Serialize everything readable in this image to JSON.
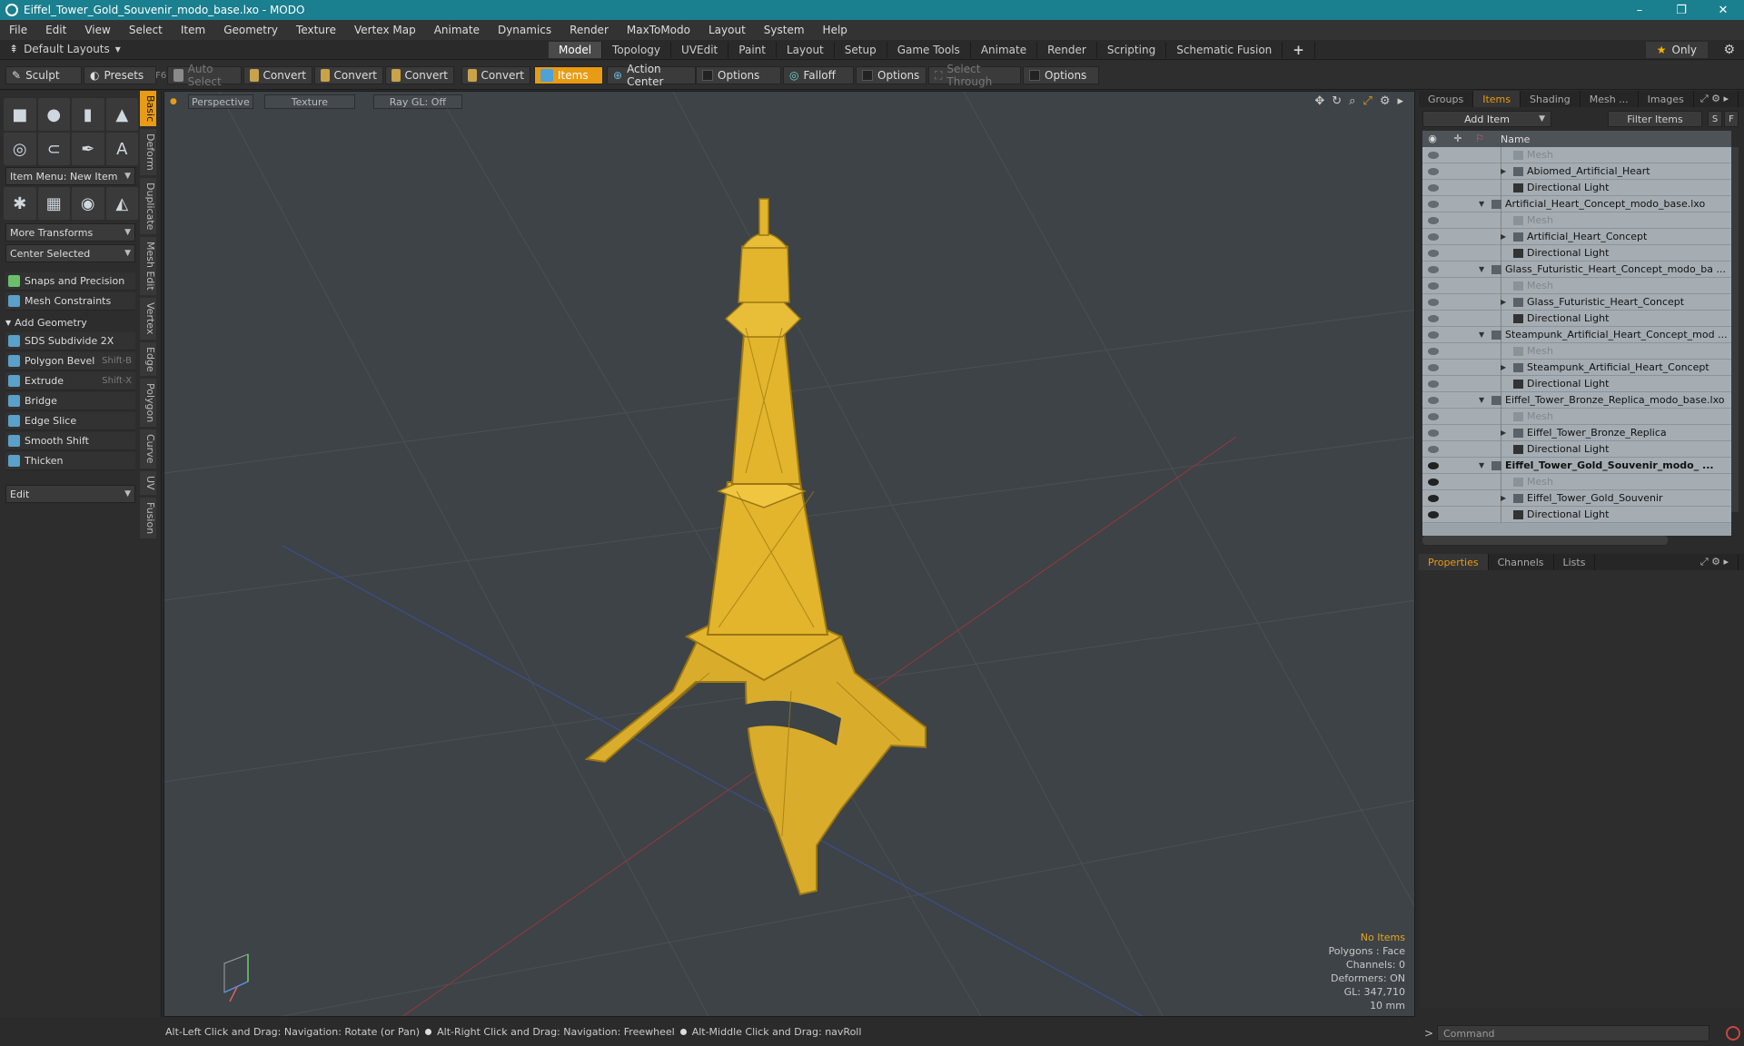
{
  "window": {
    "title": "Eiffel_Tower_Gold_Souvenir_modo_base.lxo - MODO",
    "controls": [
      "–",
      "❐",
      "✕"
    ]
  },
  "menu": [
    "File",
    "Edit",
    "View",
    "Select",
    "Item",
    "Geometry",
    "Texture",
    "Vertex Map",
    "Animate",
    "Dynamics",
    "Render",
    "MaxToModo",
    "Layout",
    "System",
    "Help"
  ],
  "layoutbar": {
    "layouts_label": "Default Layouts",
    "tabs": [
      "Model",
      "Topology",
      "UVEdit",
      "Paint",
      "Layout",
      "Setup",
      "Game Tools",
      "Animate",
      "Render",
      "Scripting",
      "Schematic Fusion"
    ],
    "active_tab": "Model",
    "plus": "+",
    "only_label": "Only"
  },
  "toolbar": {
    "sculpt": "Sculpt",
    "presets": "Presets",
    "presets_key": "F6",
    "auto_select": "Auto Select",
    "convert1": "Convert",
    "convert2": "Convert",
    "convert3": "Convert",
    "convert4": "Convert",
    "items": "Items",
    "action_center": "Action Center",
    "options1": "Options",
    "falloff": "Falloff",
    "options2": "Options",
    "select_through": "Select Through",
    "options3": "Options"
  },
  "leftpanel": {
    "item_menu": "Item Menu: New Item",
    "more_transforms": "More Transforms",
    "center_selected": "Center Selected",
    "snaps": "Snaps and Precision",
    "mesh_constraints": "Mesh Constraints",
    "add_geometry": "Add Geometry",
    "tools": [
      {
        "label": "SDS Subdivide 2X",
        "shortcut": ""
      },
      {
        "label": "Polygon Bevel",
        "shortcut": "Shift-B"
      },
      {
        "label": "Extrude",
        "shortcut": "Shift-X"
      },
      {
        "label": "Bridge",
        "shortcut": ""
      },
      {
        "label": "Edge Slice",
        "shortcut": ""
      },
      {
        "label": "Smooth Shift",
        "shortcut": ""
      },
      {
        "label": "Thicken",
        "shortcut": ""
      }
    ],
    "edit": "Edit",
    "side_tabs": [
      "Basic",
      "Deform",
      "Duplicate",
      "Mesh Edit",
      "Vertex",
      "Edge",
      "Polygon",
      "Curve",
      "UV",
      "Fusion"
    ]
  },
  "viewport": {
    "view": "Perspective",
    "shading": "Texture",
    "raygl": "Ray GL: Off",
    "info": {
      "no_items": "No Items",
      "polygons": "Polygons : Face",
      "channels": "Channels: 0",
      "deformers": "Deformers: ON",
      "gl": "GL: 347,710",
      "scale": "10 mm"
    },
    "colors": {
      "background": "#3d4347",
      "tower": "#e2b52d",
      "tower_dark": "#9c7712"
    }
  },
  "statusbar": {
    "hint1": "Alt-Left Click and Drag: Navigation: Rotate (or Pan)",
    "hint2": "Alt-Right Click and Drag: Navigation: Freewheel",
    "hint3": "Alt-Middle Click and Drag: navRoll"
  },
  "rightpanel": {
    "tabs": [
      "Groups",
      "Items",
      "Shading",
      "Mesh ...",
      "Images"
    ],
    "active_tab": "Items",
    "add_item": "Add Item",
    "filter_items": "Filter Items",
    "btn_s": "S",
    "btn_f": "F",
    "column_name": "Name",
    "tree": [
      {
        "label": "Mesh",
        "type": "mesh",
        "indent": 2,
        "tri": ""
      },
      {
        "label": "Abiomed_Artificial_Heart",
        "type": "item",
        "indent": 2,
        "tri": "▶"
      },
      {
        "label": "Directional Light",
        "type": "light",
        "indent": 2,
        "tri": ""
      },
      {
        "label": "Artificial_Heart_Concept_modo_base.lxo",
        "type": "scene",
        "indent": 1,
        "tri": "▼"
      },
      {
        "label": "Mesh",
        "type": "mesh",
        "indent": 2,
        "tri": ""
      },
      {
        "label": "Artificial_Heart_Concept",
        "type": "item",
        "indent": 2,
        "tri": "▶"
      },
      {
        "label": "Directional Light",
        "type": "light",
        "indent": 2,
        "tri": ""
      },
      {
        "label": "Glass_Futuristic_Heart_Concept_modo_ba ...",
        "type": "scene",
        "indent": 1,
        "tri": "▼"
      },
      {
        "label": "Mesh",
        "type": "mesh",
        "indent": 2,
        "tri": ""
      },
      {
        "label": "Glass_Futuristic_Heart_Concept",
        "type": "item",
        "indent": 2,
        "tri": "▶"
      },
      {
        "label": "Directional Light",
        "type": "light",
        "indent": 2,
        "tri": ""
      },
      {
        "label": "Steampunk_Artificial_Heart_Concept_mod ...",
        "type": "scene",
        "indent": 1,
        "tri": "▼"
      },
      {
        "label": "Mesh",
        "type": "mesh",
        "indent": 2,
        "tri": ""
      },
      {
        "label": "Steampunk_Artificial_Heart_Concept",
        "type": "item",
        "indent": 2,
        "tri": "▶"
      },
      {
        "label": "Directional Light",
        "type": "light",
        "indent": 2,
        "tri": ""
      },
      {
        "label": "Eiffel_Tower_Bronze_Replica_modo_base.lxo",
        "type": "scene",
        "indent": 1,
        "tri": "▼"
      },
      {
        "label": "Mesh",
        "type": "mesh",
        "indent": 2,
        "tri": ""
      },
      {
        "label": "Eiffel_Tower_Bronze_Replica",
        "type": "item",
        "indent": 2,
        "tri": "▶"
      },
      {
        "label": "Directional Light",
        "type": "light",
        "indent": 2,
        "tri": ""
      },
      {
        "label": "Eiffel_Tower_Gold_Souvenir_modo_ ...",
        "type": "scene",
        "indent": 1,
        "tri": "▼",
        "bold": true
      },
      {
        "label": "Mesh",
        "type": "mesh",
        "indent": 2,
        "tri": ""
      },
      {
        "label": "Eiffel_Tower_Gold_Souvenir",
        "type": "item",
        "indent": 2,
        "tri": "▶"
      },
      {
        "label": "Directional Light",
        "type": "light",
        "indent": 2,
        "tri": ""
      }
    ],
    "props_tabs": [
      "Properties",
      "Channels",
      "Lists"
    ],
    "props_active": "Properties",
    "command_placeholder": "Command"
  }
}
